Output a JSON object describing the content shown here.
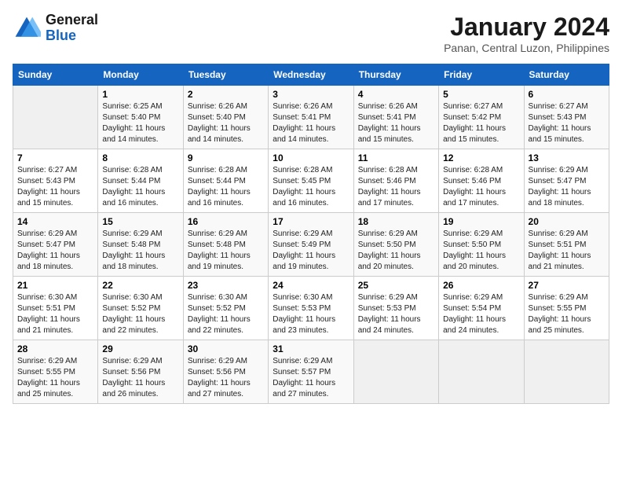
{
  "header": {
    "logo_general": "General",
    "logo_blue": "Blue",
    "month": "January 2024",
    "location": "Panan, Central Luzon, Philippines"
  },
  "days_of_week": [
    "Sunday",
    "Monday",
    "Tuesday",
    "Wednesday",
    "Thursday",
    "Friday",
    "Saturday"
  ],
  "weeks": [
    [
      {
        "day": "",
        "sunrise": "",
        "sunset": "",
        "daylight": ""
      },
      {
        "day": "1",
        "sunrise": "Sunrise: 6:25 AM",
        "sunset": "Sunset: 5:40 PM",
        "daylight": "Daylight: 11 hours and 14 minutes."
      },
      {
        "day": "2",
        "sunrise": "Sunrise: 6:26 AM",
        "sunset": "Sunset: 5:40 PM",
        "daylight": "Daylight: 11 hours and 14 minutes."
      },
      {
        "day": "3",
        "sunrise": "Sunrise: 6:26 AM",
        "sunset": "Sunset: 5:41 PM",
        "daylight": "Daylight: 11 hours and 14 minutes."
      },
      {
        "day": "4",
        "sunrise": "Sunrise: 6:26 AM",
        "sunset": "Sunset: 5:41 PM",
        "daylight": "Daylight: 11 hours and 15 minutes."
      },
      {
        "day": "5",
        "sunrise": "Sunrise: 6:27 AM",
        "sunset": "Sunset: 5:42 PM",
        "daylight": "Daylight: 11 hours and 15 minutes."
      },
      {
        "day": "6",
        "sunrise": "Sunrise: 6:27 AM",
        "sunset": "Sunset: 5:43 PM",
        "daylight": "Daylight: 11 hours and 15 minutes."
      }
    ],
    [
      {
        "day": "7",
        "sunrise": "Sunrise: 6:27 AM",
        "sunset": "Sunset: 5:43 PM",
        "daylight": "Daylight: 11 hours and 15 minutes."
      },
      {
        "day": "8",
        "sunrise": "Sunrise: 6:28 AM",
        "sunset": "Sunset: 5:44 PM",
        "daylight": "Daylight: 11 hours and 16 minutes."
      },
      {
        "day": "9",
        "sunrise": "Sunrise: 6:28 AM",
        "sunset": "Sunset: 5:44 PM",
        "daylight": "Daylight: 11 hours and 16 minutes."
      },
      {
        "day": "10",
        "sunrise": "Sunrise: 6:28 AM",
        "sunset": "Sunset: 5:45 PM",
        "daylight": "Daylight: 11 hours and 16 minutes."
      },
      {
        "day": "11",
        "sunrise": "Sunrise: 6:28 AM",
        "sunset": "Sunset: 5:46 PM",
        "daylight": "Daylight: 11 hours and 17 minutes."
      },
      {
        "day": "12",
        "sunrise": "Sunrise: 6:28 AM",
        "sunset": "Sunset: 5:46 PM",
        "daylight": "Daylight: 11 hours and 17 minutes."
      },
      {
        "day": "13",
        "sunrise": "Sunrise: 6:29 AM",
        "sunset": "Sunset: 5:47 PM",
        "daylight": "Daylight: 11 hours and 18 minutes."
      }
    ],
    [
      {
        "day": "14",
        "sunrise": "Sunrise: 6:29 AM",
        "sunset": "Sunset: 5:47 PM",
        "daylight": "Daylight: 11 hours and 18 minutes."
      },
      {
        "day": "15",
        "sunrise": "Sunrise: 6:29 AM",
        "sunset": "Sunset: 5:48 PM",
        "daylight": "Daylight: 11 hours and 18 minutes."
      },
      {
        "day": "16",
        "sunrise": "Sunrise: 6:29 AM",
        "sunset": "Sunset: 5:48 PM",
        "daylight": "Daylight: 11 hours and 19 minutes."
      },
      {
        "day": "17",
        "sunrise": "Sunrise: 6:29 AM",
        "sunset": "Sunset: 5:49 PM",
        "daylight": "Daylight: 11 hours and 19 minutes."
      },
      {
        "day": "18",
        "sunrise": "Sunrise: 6:29 AM",
        "sunset": "Sunset: 5:50 PM",
        "daylight": "Daylight: 11 hours and 20 minutes."
      },
      {
        "day": "19",
        "sunrise": "Sunrise: 6:29 AM",
        "sunset": "Sunset: 5:50 PM",
        "daylight": "Daylight: 11 hours and 20 minutes."
      },
      {
        "day": "20",
        "sunrise": "Sunrise: 6:29 AM",
        "sunset": "Sunset: 5:51 PM",
        "daylight": "Daylight: 11 hours and 21 minutes."
      }
    ],
    [
      {
        "day": "21",
        "sunrise": "Sunrise: 6:30 AM",
        "sunset": "Sunset: 5:51 PM",
        "daylight": "Daylight: 11 hours and 21 minutes."
      },
      {
        "day": "22",
        "sunrise": "Sunrise: 6:30 AM",
        "sunset": "Sunset: 5:52 PM",
        "daylight": "Daylight: 11 hours and 22 minutes."
      },
      {
        "day": "23",
        "sunrise": "Sunrise: 6:30 AM",
        "sunset": "Sunset: 5:52 PM",
        "daylight": "Daylight: 11 hours and 22 minutes."
      },
      {
        "day": "24",
        "sunrise": "Sunrise: 6:30 AM",
        "sunset": "Sunset: 5:53 PM",
        "daylight": "Daylight: 11 hours and 23 minutes."
      },
      {
        "day": "25",
        "sunrise": "Sunrise: 6:29 AM",
        "sunset": "Sunset: 5:53 PM",
        "daylight": "Daylight: 11 hours and 24 minutes."
      },
      {
        "day": "26",
        "sunrise": "Sunrise: 6:29 AM",
        "sunset": "Sunset: 5:54 PM",
        "daylight": "Daylight: 11 hours and 24 minutes."
      },
      {
        "day": "27",
        "sunrise": "Sunrise: 6:29 AM",
        "sunset": "Sunset: 5:55 PM",
        "daylight": "Daylight: 11 hours and 25 minutes."
      }
    ],
    [
      {
        "day": "28",
        "sunrise": "Sunrise: 6:29 AM",
        "sunset": "Sunset: 5:55 PM",
        "daylight": "Daylight: 11 hours and 25 minutes."
      },
      {
        "day": "29",
        "sunrise": "Sunrise: 6:29 AM",
        "sunset": "Sunset: 5:56 PM",
        "daylight": "Daylight: 11 hours and 26 minutes."
      },
      {
        "day": "30",
        "sunrise": "Sunrise: 6:29 AM",
        "sunset": "Sunset: 5:56 PM",
        "daylight": "Daylight: 11 hours and 27 minutes."
      },
      {
        "day": "31",
        "sunrise": "Sunrise: 6:29 AM",
        "sunset": "Sunset: 5:57 PM",
        "daylight": "Daylight: 11 hours and 27 minutes."
      },
      {
        "day": "",
        "sunrise": "",
        "sunset": "",
        "daylight": ""
      },
      {
        "day": "",
        "sunrise": "",
        "sunset": "",
        "daylight": ""
      },
      {
        "day": "",
        "sunrise": "",
        "sunset": "",
        "daylight": ""
      }
    ]
  ]
}
